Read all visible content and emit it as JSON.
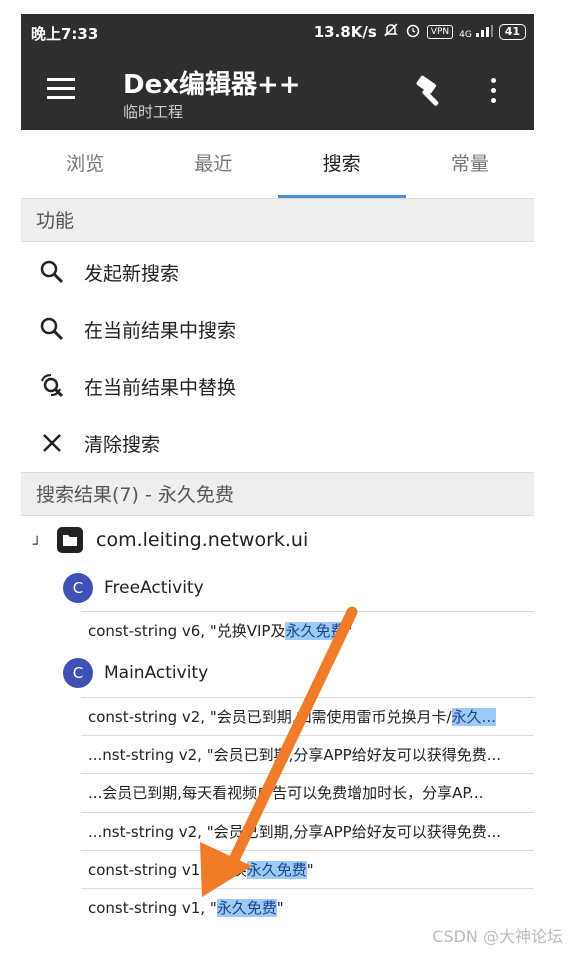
{
  "status_bar": {
    "time": "晚上7:33",
    "speed": "13.8K/s",
    "vpn": "VPN",
    "signal": "4G",
    "battery": "41"
  },
  "toolbar": {
    "title": "Dex编辑器++",
    "subtitle": "临时工程"
  },
  "tabs": [
    {
      "label": "浏览"
    },
    {
      "label": "最近"
    },
    {
      "label": "搜索",
      "active": true
    },
    {
      "label": "常量"
    }
  ],
  "functions": {
    "header": "功能",
    "items": [
      {
        "label": "发起新搜索",
        "icon": "search-icon"
      },
      {
        "label": "在当前结果中搜索",
        "icon": "search-icon"
      },
      {
        "label": "在当前结果中替换",
        "icon": "replace-icon"
      },
      {
        "label": "清除搜索",
        "icon": "close-icon"
      }
    ]
  },
  "results": {
    "header": "搜索结果(7) - 永久免费",
    "package": "com.leiting.network.ui",
    "classes": [
      {
        "name": "FreeActivity",
        "badge": "C",
        "rows": [
          {
            "pre": "const-string v6, \"兑换VIP及",
            "hl": "永久免费",
            "post": "\""
          }
        ]
      },
      {
        "name": "MainActivity",
        "badge": "C",
        "rows": [
          {
            "pre": "const-string v2, \"会员已到期,如需使用雷币兑换月卡/",
            "hl": "永久...",
            "post": ""
          },
          {
            "pre": "...nst-string v2, \"会员已到期,分享APP给好友可以获得免费...",
            "hl": "",
            "post": ""
          },
          {
            "pre": "...会员已到期,每天看视频广告可以免费增加时长，分享AP...",
            "hl": "",
            "post": ""
          },
          {
            "pre": "...nst-string v2, \"会员已到期,分享APP给好友可以获得免费...",
            "hl": "",
            "post": ""
          },
          {
            "pre": "const-string v1, \"兑换",
            "hl": "永久免费",
            "post": "\""
          },
          {
            "pre": "const-string v1, \"",
            "hl": "永久免费",
            "post": "\""
          }
        ]
      }
    ]
  },
  "watermark": "CSDN @大神论坛",
  "colors": {
    "bar": "#2e2e2e",
    "accent": "#4a90d9",
    "badge": "#3f51b5",
    "highlight": "#9ecbf5",
    "arrow": "#f07c2a"
  }
}
